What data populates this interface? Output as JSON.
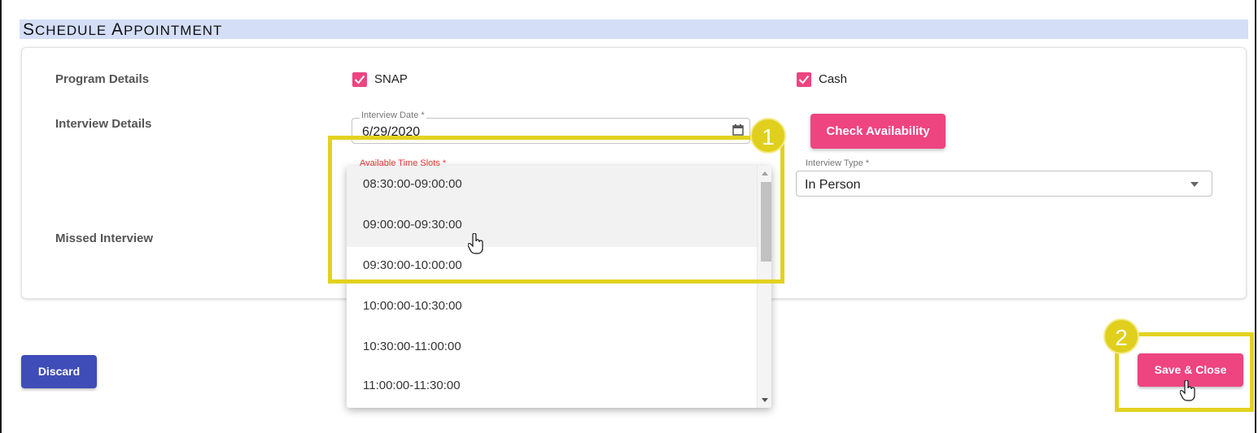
{
  "header": {
    "title_first": "S",
    "title_rest1": "CHEDULE ",
    "title_a": "A",
    "title_rest2": "PPOINTMENT"
  },
  "rows": {
    "program_details": "Program Details",
    "interview_details": "Interview Details",
    "missed_interview": "Missed Interview"
  },
  "programs": {
    "snap": "SNAP",
    "cash": "Cash"
  },
  "interview_date": {
    "label": "Interview Date *",
    "value": "6/29/2020"
  },
  "check_availability": "Check Availability",
  "time_slots": {
    "label": "Available Time Slots *",
    "options": [
      "08:30:00-09:00:00",
      "09:00:00-09:30:00",
      "09:30:00-10:00:00",
      "10:00:00-10:30:00",
      "10:30:00-11:00:00",
      "11:00:00-11:30:00"
    ]
  },
  "interview_type": {
    "label": "Interview Type *",
    "value": "In Person"
  },
  "buttons": {
    "discard": "Discard",
    "save_close": "Save & Close"
  },
  "callouts": {
    "one": "1",
    "two": "2"
  },
  "colors": {
    "accent": "#ee4480",
    "primary": "#3f4db8",
    "highlight": "#e2d21f",
    "header_bg": "#d4def7"
  }
}
